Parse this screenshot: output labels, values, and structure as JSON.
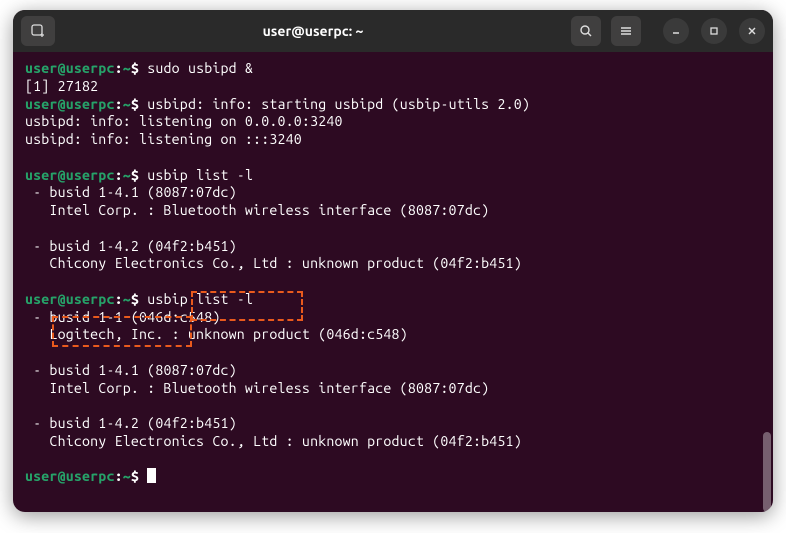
{
  "title": "user@userpc: ~",
  "prompt": {
    "user": "user@userpc",
    "sep": ":",
    "path": "~",
    "end": "$ "
  },
  "cmd": {
    "c1": "sudo usbipd &",
    "c2": "usbip list -l",
    "c3": "usbip list -l"
  },
  "out": {
    "l1": "[1] 27182",
    "l2": "usbipd: info: starting usbipd (usbip-utils 2.0)",
    "l3": "usbipd: info: listening on 0.0.0.0:3240",
    "l4": "usbipd: info: listening on :::3240",
    "dev1a": " - busid 1-4.1 (8087:07dc)",
    "dev1b": "   Intel Corp. : Bluetooth wireless interface (8087:07dc)",
    "dev2a": " - busid 1-4.2 (04f2:b451)",
    "dev2b": "   Chicony Electronics Co., Ltd : unknown product (04f2:b451)",
    "dev3a": " - busid 1-1 (046d:c548)",
    "dev3b": "   Logitech, Inc. : unknown product (046d:c548)",
    "dev4a": " - busid 1-4.1 (8087:07dc)",
    "dev4b": "   Intel Corp. : Bluetooth wireless interface (8087:07dc)",
    "dev5a": " - busid 1-4.2 (04f2:b451)",
    "dev5b": "   Chicony Electronics Co., Ltd : unknown product (04f2:b451)"
  }
}
